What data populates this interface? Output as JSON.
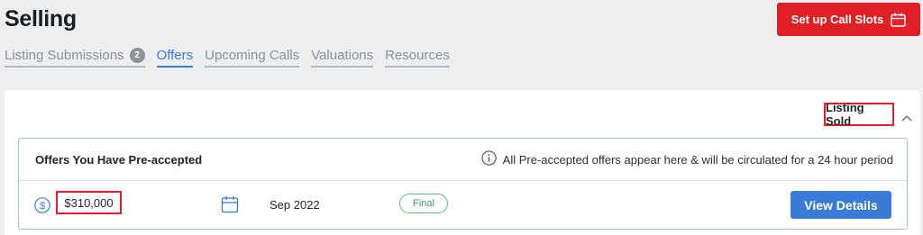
{
  "header": {
    "title": "Selling",
    "cta_label": "Set up Call Slots"
  },
  "tabs": [
    {
      "label": "Listing Submissions",
      "badge": "2",
      "active": false
    },
    {
      "label": "Offers",
      "active": true
    },
    {
      "label": "Upcoming Calls",
      "active": false
    },
    {
      "label": "Valuations",
      "active": false
    },
    {
      "label": "Resources",
      "active": false
    }
  ],
  "card": {
    "section_label": "Listing Sold",
    "offers": {
      "title": "Offers You Have Pre-accepted",
      "info_text": "All Pre-accepted offers appear here & will be circulated for a 24 hour period",
      "rows": [
        {
          "price": "$310,000",
          "date": "Sep 2022",
          "status": "Final",
          "action_label": "View Details"
        }
      ]
    }
  },
  "colors": {
    "brand_red": "#e01f26",
    "accent_blue": "#3a7bd5",
    "status_green": "#3e9d5f"
  },
  "icons": [
    "calendar-icon",
    "chevron-up-icon",
    "info-icon",
    "dollar-icon"
  ]
}
